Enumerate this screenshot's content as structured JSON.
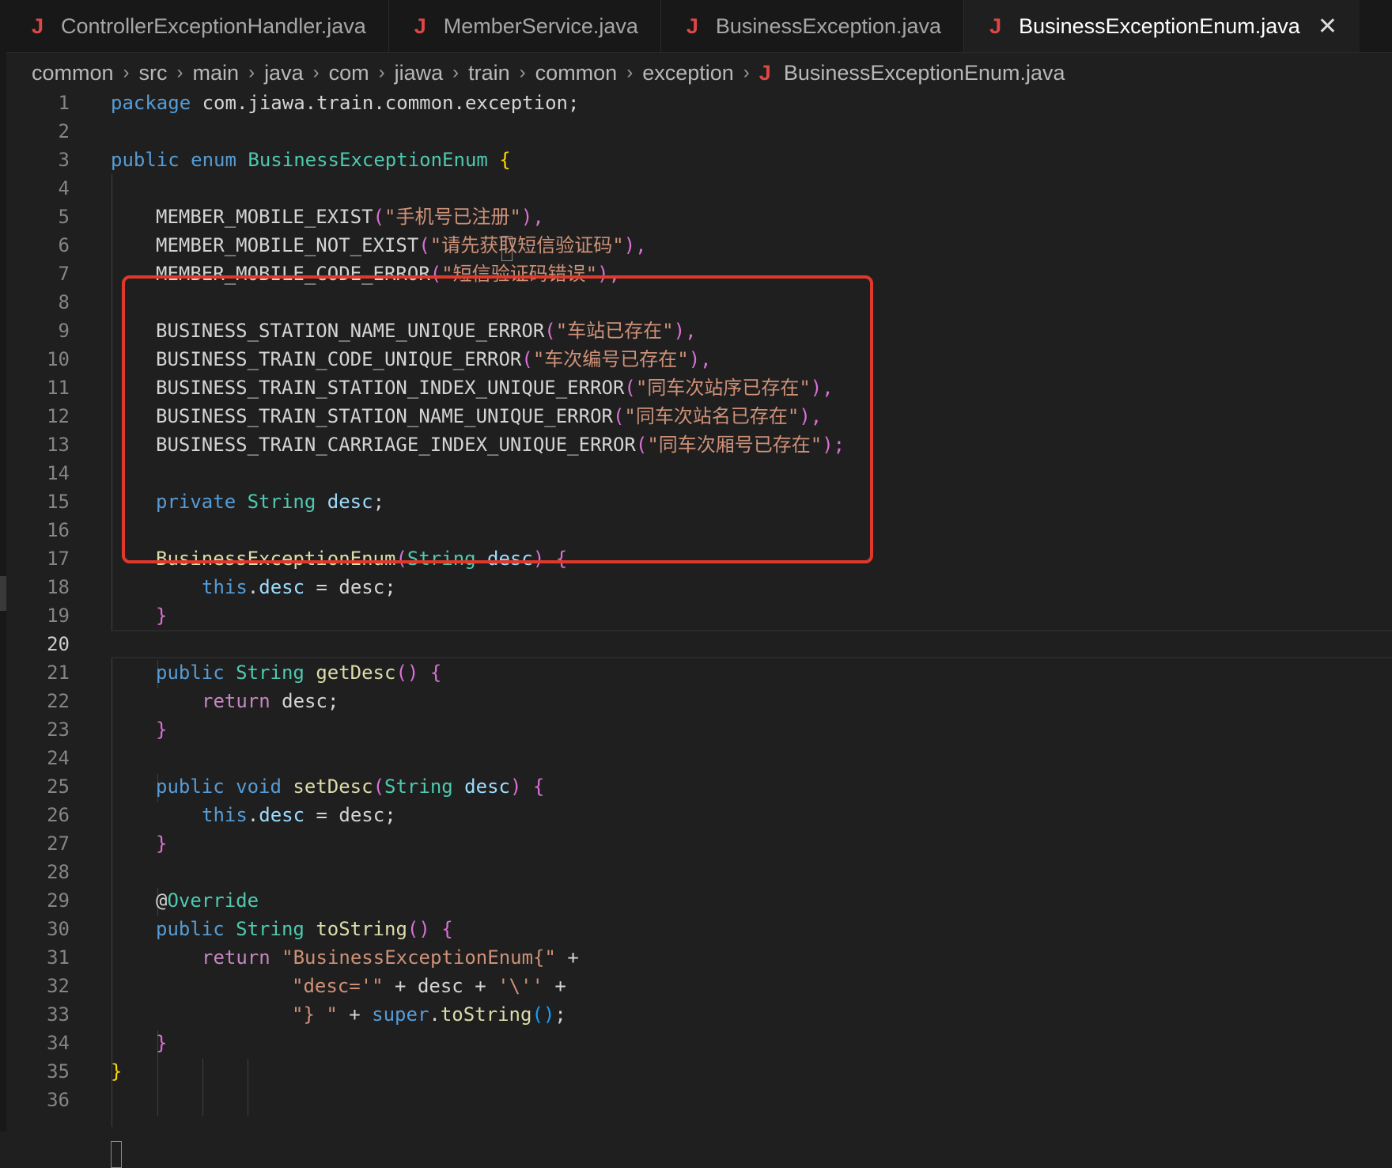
{
  "tabs": [
    {
      "label": "ControllerExceptionHandler.java",
      "icon": "java-file-icon",
      "active": false
    },
    {
      "label": "MemberService.java",
      "icon": "java-file-icon",
      "active": false
    },
    {
      "label": "BusinessException.java",
      "icon": "java-file-icon",
      "active": false
    },
    {
      "label": "BusinessExceptionEnum.java",
      "icon": "java-file-icon",
      "active": true
    }
  ],
  "tab_icon_glyph": "J",
  "close_glyph": "✕",
  "breadcrumb": [
    "common",
    "src",
    "main",
    "java",
    "com",
    "jiawa",
    "train",
    "common",
    "exception"
  ],
  "breadcrumb_file": "BusinessExceptionEnum.java",
  "breadcrumb_sep": "›",
  "line_numbers": [
    "1",
    "2",
    "3",
    "4",
    "5",
    "6",
    "7",
    "8",
    "9",
    "10",
    "11",
    "12",
    "13",
    "14",
    "15",
    "16",
    "17",
    "18",
    "19",
    "20",
    "21",
    "22",
    "23",
    "24",
    "25",
    "26",
    "27",
    "28",
    "29",
    "30",
    "31",
    "32",
    "33",
    "34",
    "35",
    "36"
  ],
  "current_line": 20,
  "colors": {
    "highlight_box": "#e0392b",
    "java_icon": "#e04646",
    "background": "#1f1f1f"
  },
  "code": {
    "l1": {
      "k": "package",
      "t": " com.jiawa.train.common.exception;"
    },
    "l3": {
      "a": "public",
      "b": "enum",
      "c": "BusinessExceptionEnum",
      "d": "{"
    },
    "l5": {
      "n": "MEMBER_MOBILE_EXIST",
      "p": "(",
      "s": "\"手机号已注册\"",
      "q": "),"
    },
    "l6": {
      "n": "MEMBER_MOBILE_NOT_EXIST",
      "p": "(",
      "s": "\"请先获取短信验证码\"",
      "q": "),"
    },
    "l7": {
      "n": "MEMBER_MOBILE_CODE_ERROR",
      "p": "(",
      "s": "\"短信验证码错误\"",
      "q": "),"
    },
    "l9": {
      "n": "BUSINESS_STATION_NAME_UNIQUE_ERROR",
      "p": "(",
      "s": "\"车站已存在\"",
      "q": "),"
    },
    "l10": {
      "n": "BUSINESS_TRAIN_CODE_UNIQUE_ERROR",
      "p": "(",
      "s": "\"车次编号已存在\"",
      "q": "),"
    },
    "l11": {
      "n": "BUSINESS_TRAIN_STATION_INDEX_UNIQUE_ERROR",
      "p": "(",
      "s": "\"同车次站序已存在\"",
      "q": "),"
    },
    "l12": {
      "n": "BUSINESS_TRAIN_STATION_NAME_UNIQUE_ERROR",
      "p": "(",
      "s": "\"同车次站名已存在\"",
      "q": "),"
    },
    "l13": {
      "n": "BUSINESS_TRAIN_CARRIAGE_INDEX_UNIQUE_ERROR",
      "p": "(",
      "s": "\"同车次厢号已存在\"",
      "q": ");"
    },
    "l15": {
      "a": "private",
      "b": "String",
      "c": "desc",
      "d": ";"
    },
    "l17": {
      "a": "BusinessExceptionEnum",
      "b": "(",
      "c": "String",
      "d": "desc",
      "e": ")",
      "f": "{"
    },
    "l18": {
      "a": "this",
      "b": ".",
      "c": "desc",
      "d": " = desc;"
    },
    "l19": {
      "a": "}"
    },
    "l21": {
      "a": "public",
      "b": "String",
      "c": "getDesc",
      "d": "()",
      "e": "{"
    },
    "l22": {
      "a": "return",
      "b": " desc;"
    },
    "l23": {
      "a": "}"
    },
    "l25": {
      "a": "public",
      "b": "void",
      "c": "setDesc",
      "d": "(",
      "e": "String",
      "f": "desc",
      "g": ")",
      "h": "{"
    },
    "l26": {
      "a": "this",
      "b": ".",
      "c": "desc",
      "d": " = desc;"
    },
    "l27": {
      "a": "}"
    },
    "l29": {
      "a": "@",
      "b": "Override"
    },
    "l30": {
      "a": "public",
      "b": "String",
      "c": "toString",
      "d": "()",
      "e": "{"
    },
    "l31": {
      "a": "return",
      "b": "\"BusinessExceptionEnum{\"",
      "c": " +"
    },
    "l32": {
      "a": "\"desc='\"",
      "b": " + desc + ",
      "c": "'\\''",
      "d": " +"
    },
    "l33": {
      "a": "\"} \"",
      "b": " + ",
      "c": "super",
      "d": ".",
      "e": "toString",
      "f": "()",
      "g": ";"
    },
    "l34": {
      "a": "}"
    },
    "l35": {
      "a": "}"
    }
  }
}
